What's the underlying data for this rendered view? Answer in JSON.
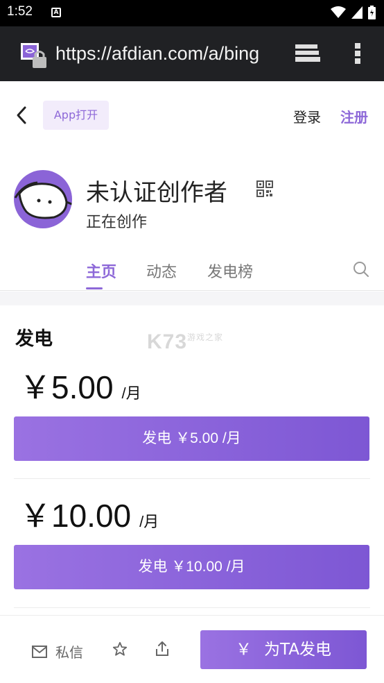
{
  "status_bar": {
    "time": "1:52",
    "badge": "A"
  },
  "browser": {
    "url": "https://afdian.com/a/bing"
  },
  "topnav": {
    "app_open": "App打开",
    "login": "登录",
    "register": "注册"
  },
  "profile": {
    "name": "未认证创作者",
    "status": "正在创作"
  },
  "tabs": [
    {
      "label": "主页",
      "active": true
    },
    {
      "label": "动态",
      "active": false
    },
    {
      "label": "发电榜",
      "active": false
    }
  ],
  "section": {
    "title": "发电"
  },
  "tiers": [
    {
      "price": "￥5.00",
      "unit": "/月",
      "button": "发电 ￥5.00 /月"
    },
    {
      "price": "￥10.00",
      "unit": "/月",
      "button": "发电 ￥10.00 /月"
    }
  ],
  "watermark": {
    "logo": "K73",
    "sub": "游戏之家"
  },
  "bottom": {
    "message": "私信",
    "cta_symbol": "￥",
    "cta_label": "为TA发电"
  },
  "colors": {
    "accent": "#8d68d8",
    "button_start": "#9a72e2",
    "button_end": "#7d57d4"
  }
}
